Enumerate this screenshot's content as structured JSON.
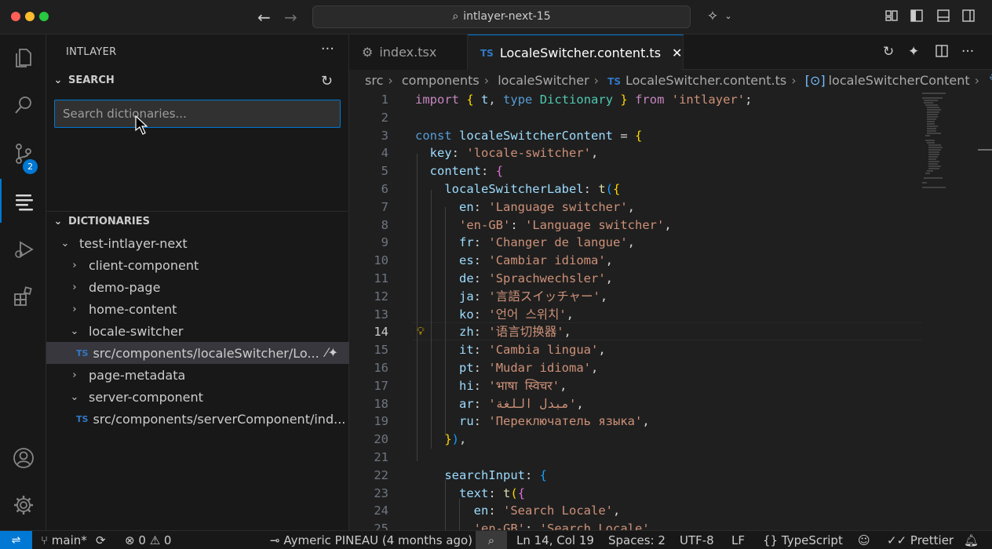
{
  "window": {
    "command_center": "intlayer-next-15"
  },
  "activity_bar": {
    "scm_badge": "2"
  },
  "sidebar": {
    "title": "INTLAYER",
    "search_section": "SEARCH",
    "search_placeholder": "Search dictionaries...",
    "dictionaries_section": "DICTIONARIES",
    "tree": [
      {
        "label": "test-intlayer-next",
        "chevron": "⌄"
      },
      {
        "label": "client-component",
        "chevron": "›"
      },
      {
        "label": "demo-page",
        "chevron": "›"
      },
      {
        "label": "home-content",
        "chevron": "›"
      },
      {
        "label": "locale-switcher",
        "chevron": "⌄"
      },
      {
        "label": "src/components/localeSwitcher/Lo...",
        "file": "TS"
      },
      {
        "label": "page-metadata",
        "chevron": "›"
      },
      {
        "label": "server-component",
        "chevron": "⌄"
      },
      {
        "label": "src/components/serverComponent/ind...",
        "file": "TS"
      }
    ]
  },
  "tabs": [
    {
      "label": "index.tsx"
    },
    {
      "label": "LocaleSwitcher.content.ts",
      "icon": "TS"
    }
  ],
  "breadcrumb": {
    "parts": [
      "src",
      "components",
      "localeSwitcher",
      "LocaleSwitcher.content.ts",
      "localeSwitcherContent",
      "co"
    ],
    "file_icon": "TS"
  },
  "editor": {
    "current_line": 14,
    "line_numbers": [
      "1",
      "2",
      "3",
      "4",
      "5",
      "6",
      "7",
      "8",
      "9",
      "10",
      "11",
      "12",
      "13",
      "14",
      "15",
      "16",
      "17",
      "18",
      "19",
      "20",
      "21",
      "22",
      "23",
      "24",
      "25"
    ]
  },
  "statusbar": {
    "branch": "main*",
    "errors": "0",
    "warnings": "0",
    "blame": "Aymeric PINEAU (4 months ago)",
    "position": "Ln 14, Col 19",
    "spaces": "Spaces: 2",
    "encoding": "UTF-8",
    "eol": "LF",
    "language": "TypeScript",
    "formatter": "Prettier"
  },
  "colors": {
    "accent": "#0078d4",
    "ts_blue": "#3178c6",
    "string": "#ce9178",
    "keyword": "#569cd6"
  }
}
